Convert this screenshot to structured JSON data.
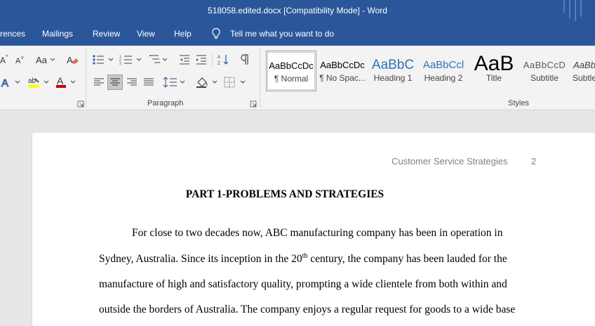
{
  "window": {
    "title": "518058.edited.docx [Compatibility Mode]  -  Word"
  },
  "menu": {
    "items": [
      "rences",
      "Mailings",
      "Review",
      "View",
      "Help"
    ],
    "tell_me": "Tell me what you want to do"
  },
  "ribbon": {
    "font_group": {
      "case_label": "Aa"
    },
    "paragraph_group": {
      "label": "Paragraph"
    },
    "styles_group": {
      "label": "Styles",
      "styles": [
        {
          "sample": "AaBbCcDc",
          "name": "¶ Normal",
          "selected": true
        },
        {
          "sample": "AaBbCcDc",
          "name": "¶ No Spac..."
        },
        {
          "sample": "AaBbC",
          "name": "Heading 1"
        },
        {
          "sample": "AaBbCcl",
          "name": "Heading 2"
        },
        {
          "sample": "AaB",
          "name": "Title"
        },
        {
          "sample": "AaBbCcD",
          "name": "Subtitle"
        },
        {
          "sample": "AaBb",
          "name": "Subtle"
        }
      ]
    }
  },
  "colors": {
    "title_bar": "#2b579a",
    "ribbon_bg": "#f3f3f3",
    "heading1": "#2e74b5",
    "heading2": "#2e74b5",
    "subtitle": "#5a5a5a",
    "highlight": "#ffff00",
    "font_color": "#c00000"
  },
  "document": {
    "header_text": "Customer Service Strategies",
    "page_number": "2",
    "heading": "PART 1-PROBLEMS AND STRATEGIES",
    "lines": {
      "l1": "For close to two decades now, ABC manufacturing company has been in operation in",
      "l2_before": "Sydney, Australia. Since its inception in the 20",
      "l2_sup": "th",
      "l2_after": " century, the company has been lauded for the",
      "l3": "manufacture of high and satisfactory quality, prompting a wide clientele from both within and",
      "l4": "outside the borders of Australia. The company enjoys a regular request for goods to a wide base"
    }
  }
}
